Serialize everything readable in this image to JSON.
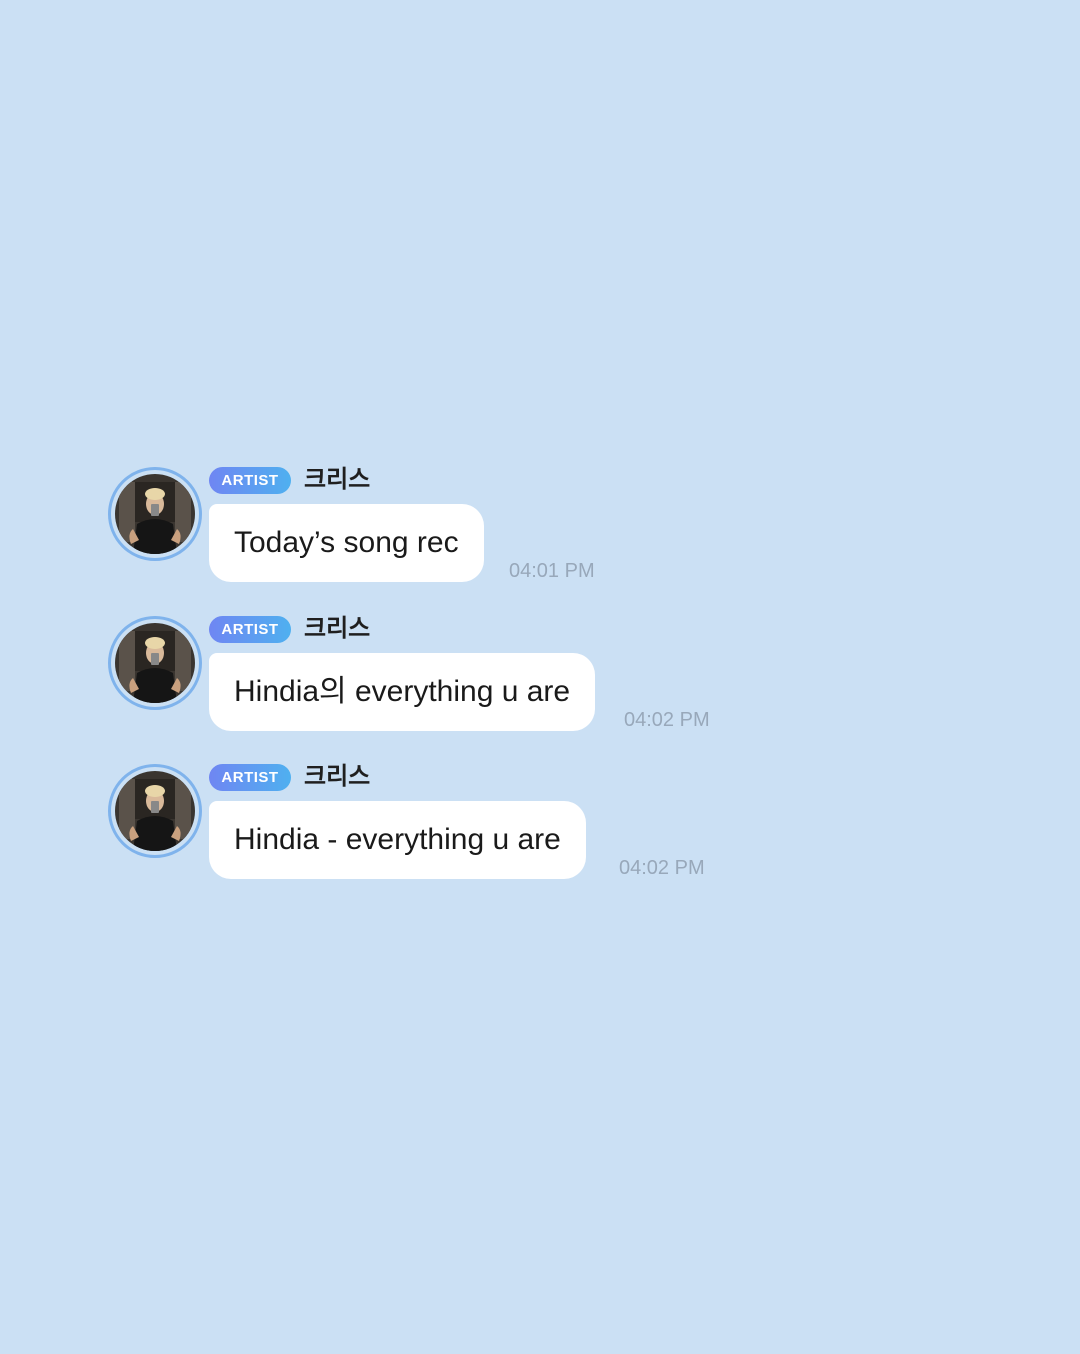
{
  "messages": [
    {
      "badge": "ARTIST",
      "sender": "크리스",
      "text": "Today’s song rec",
      "time": "04:01 PM",
      "avatar": "artist-photo"
    },
    {
      "badge": "ARTIST",
      "sender": "크리스",
      "text": "Hindia의 everything u are",
      "time": "04:02 PM",
      "avatar": "artist-photo"
    },
    {
      "badge": "ARTIST",
      "sender": "크리스",
      "text": "Hindia - everything u are",
      "time": "04:02 PM",
      "avatar": "artist-photo"
    }
  ],
  "colors": {
    "background": "#cbe0f4",
    "bubble": "#ffffff",
    "badge_start": "#6f86f2",
    "badge_end": "#4fb0f0",
    "avatar_ring": "#7fb3ec",
    "timestamp": "#98a8ba"
  }
}
